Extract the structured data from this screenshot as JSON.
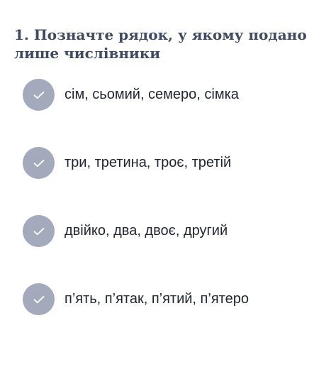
{
  "question": {
    "number": "1.",
    "title": "1. Позначте рядок, у якому подано лише числівники"
  },
  "options": [
    {
      "label": "сім, сьомий, семеро, сімка",
      "icon": "check-icon"
    },
    {
      "label": "три, третина, троє, третій",
      "icon": "check-icon"
    },
    {
      "label": "двійко, два, двоє, другий",
      "icon": "check-icon"
    },
    {
      "label": "п’ять, п’ятак, п’ятий, п’ятеро",
      "icon": "check-icon"
    }
  ],
  "colors": {
    "title": "#3d4a5f",
    "check_circle": "#a2aabb",
    "option_text": "#1f2430",
    "background": "#ffffff"
  }
}
